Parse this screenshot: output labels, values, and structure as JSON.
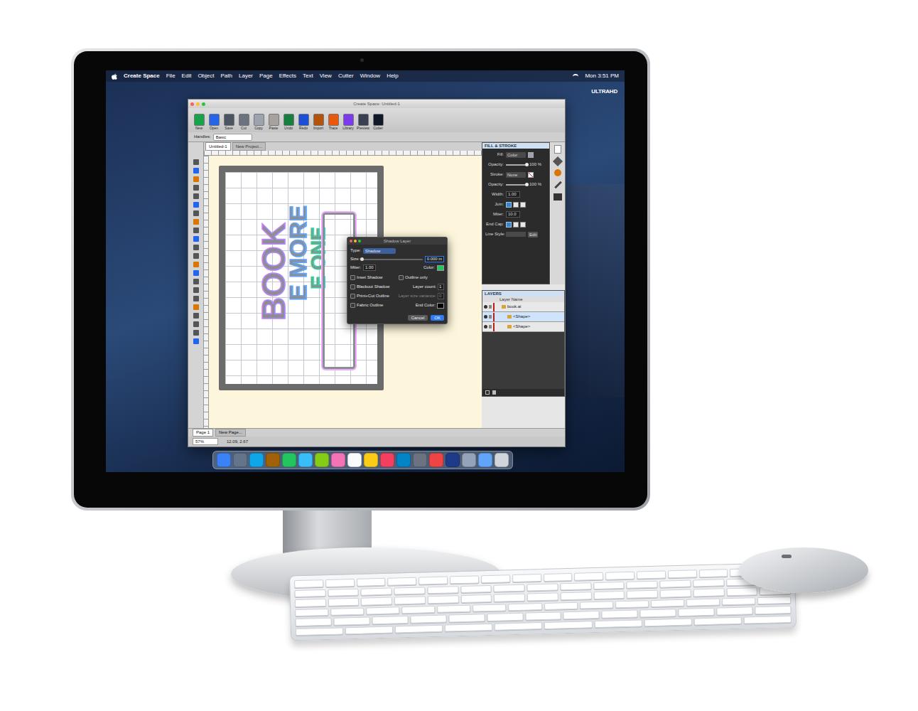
{
  "monitor": {
    "badge": "ULTRAHD"
  },
  "menubar": {
    "app": "Create Space",
    "items": [
      "File",
      "Edit",
      "Object",
      "Path",
      "Layer",
      "Page",
      "Effects",
      "Text",
      "View",
      "Cutter",
      "Window",
      "Help"
    ],
    "clock": "Mon 3:51 PM"
  },
  "window": {
    "title": "Create Space: Untitled-1",
    "toolbar": [
      {
        "label": "New",
        "color": "#16a34a"
      },
      {
        "label": "Open",
        "color": "#2563eb"
      },
      {
        "label": "Save",
        "color": "#4b5563"
      },
      {
        "label": "Cut",
        "color": "#6b7280"
      },
      {
        "label": "Copy",
        "color": "#9ca3af"
      },
      {
        "label": "Paste",
        "color": "#a8a29e"
      },
      {
        "label": "Undo",
        "color": "#15803d"
      },
      {
        "label": "Redo",
        "color": "#1d4ed8"
      },
      {
        "label": "Import",
        "color": "#b45309"
      },
      {
        "label": "Trace",
        "color": "#ea580c"
      },
      {
        "label": "Library",
        "color": "#7c3aed"
      },
      {
        "label": "Preview",
        "color": "#374151"
      },
      {
        "label": "Cutter",
        "color": "#111827"
      }
    ],
    "handles": {
      "label": "Handles:",
      "value": "Basic"
    },
    "tabs": [
      {
        "label": "Untitled-1",
        "selected": true
      },
      {
        "label": "New Project...",
        "selected": false
      }
    ],
    "pages": [
      {
        "label": "Page 1",
        "selected": true
      },
      {
        "label": "New Page...",
        "selected": false
      }
    ],
    "zoom": "57%",
    "coords": "12.09, 2.67"
  },
  "artwork": {
    "texts": [
      "BOOK",
      "E MORE",
      "E ONE"
    ]
  },
  "dialog": {
    "title": "Shadow Layer",
    "type": {
      "label": "Type:",
      "value": "Shadow"
    },
    "size": {
      "label": "Size:",
      "value": "0.000 in",
      "level": 0
    },
    "miter": {
      "label": "Miter:",
      "value": "1.00"
    },
    "color": {
      "label": "Color:",
      "color": "#22c55e"
    },
    "left_options": [
      {
        "label": "Inset Shadow",
        "checked": false
      },
      {
        "label": "Blackout Shadow",
        "checked": false
      },
      {
        "label": "Print+Cut Outline",
        "checked": false
      },
      {
        "label": "Fabric Outline",
        "checked": false
      }
    ],
    "right_options": [
      {
        "kind": "checkbox",
        "label": "Outline only",
        "checked": false
      },
      {
        "kind": "field",
        "label": "Layer count:",
        "value": "1",
        "disabled": false
      },
      {
        "kind": "field",
        "label": "Layer size variance:",
        "value": "0",
        "disabled": true
      },
      {
        "kind": "swatch",
        "label": "End Color:",
        "color": "#000000"
      }
    ],
    "buttons": [
      {
        "label": "Cancel",
        "default": false
      },
      {
        "label": "OK",
        "default": true
      }
    ]
  },
  "fill_stroke": {
    "title": "FILL & STROKE",
    "rows": [
      {
        "kind": "select",
        "label": "Fill:",
        "value": "Color",
        "swatch": "#9ca3af"
      },
      {
        "kind": "slider",
        "label": "Opacity:",
        "level": 1,
        "value": "100 %"
      },
      {
        "kind": "select",
        "label": "Stroke:",
        "value": "None",
        "swatch": "none"
      },
      {
        "kind": "slider",
        "label": "Opacity:",
        "level": 1,
        "value": "100 %"
      },
      {
        "kind": "field",
        "label": "Width:",
        "value": "1.00"
      },
      {
        "kind": "icons",
        "label": "Join:"
      },
      {
        "kind": "field",
        "label": "Miter:",
        "value": "10.0"
      },
      {
        "kind": "icons",
        "label": "End Cap:"
      },
      {
        "kind": "button",
        "label": "Line Style:",
        "value": "",
        "button": "Edit"
      }
    ]
  },
  "layers": {
    "title": "LAYERS",
    "column": "Layer Name",
    "rows": [
      {
        "name": "book.ai",
        "kind": "group",
        "selected": false
      },
      {
        "name": "<Shape>",
        "kind": "item",
        "selected": true
      },
      {
        "name": "<Shape>",
        "kind": "item",
        "selected": false
      }
    ]
  },
  "dock": [
    {
      "color": "#3b82f6"
    },
    {
      "color": "#64748b"
    },
    {
      "color": "#0ea5e9"
    },
    {
      "color": "#a16207"
    },
    {
      "color": "#22c55e"
    },
    {
      "color": "#38bdf8"
    },
    {
      "color": "#84cc16"
    },
    {
      "color": "#f472b6"
    },
    {
      "color": "#f8fafc"
    },
    {
      "color": "#facc15"
    },
    {
      "color": "#f43f5e"
    },
    {
      "color": "#0284c7"
    },
    {
      "color": "#6b7280"
    },
    {
      "color": "#ef4444"
    },
    {
      "color": "#1e3a8a"
    },
    {
      "color": "#94a3b8"
    },
    {
      "color": "#60a5fa"
    },
    {
      "color": "#d1d5db"
    }
  ]
}
